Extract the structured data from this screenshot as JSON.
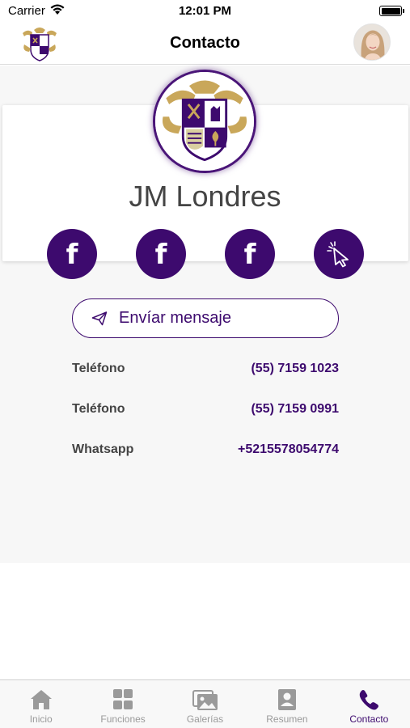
{
  "status_bar": {
    "carrier": "Carrier",
    "time": "12:01 PM"
  },
  "nav": {
    "title": "Contacto"
  },
  "profile": {
    "name": "JM Londres"
  },
  "social": [
    {
      "icon": "facebook-icon",
      "glyph": "f"
    },
    {
      "icon": "facebook-icon",
      "glyph": "f"
    },
    {
      "icon": "facebook-icon",
      "glyph": "f"
    },
    {
      "icon": "cursor-click-icon",
      "glyph": ""
    }
  ],
  "send_message": {
    "label": "Envíar mensaje",
    "icon": "paper-plane-icon"
  },
  "contacts": [
    {
      "label": "Teléfono",
      "value": "(55) 7159 1023"
    },
    {
      "label": "Teléfono",
      "value": "(55) 7159 0991"
    },
    {
      "label": "Whatsapp",
      "value": "+5215578054774"
    }
  ],
  "tabs": [
    {
      "label": "Inicio",
      "icon": "home-icon",
      "active": false
    },
    {
      "label": "Funciones",
      "icon": "grid-icon",
      "active": false
    },
    {
      "label": "Galerías",
      "icon": "gallery-icon",
      "active": false
    },
    {
      "label": "Resumen",
      "icon": "profile-card-icon",
      "active": false
    },
    {
      "label": "Contacto",
      "icon": "phone-icon",
      "active": true
    }
  ],
  "colors": {
    "brand": "#3d0a6e",
    "gold": "#c9a75a",
    "inactive_tab": "#9a9a9a"
  }
}
